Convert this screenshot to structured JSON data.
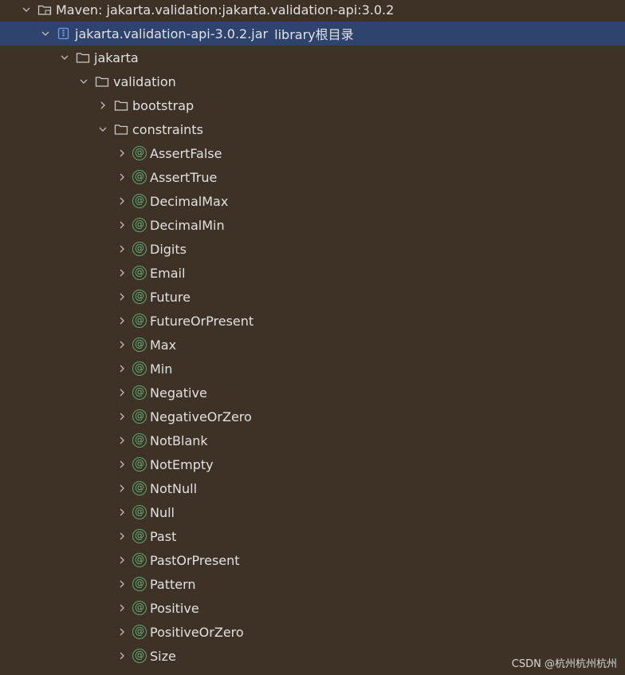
{
  "tree": {
    "root_label": "Maven: jakarta.validation:jakarta.validation-api:3.0.2",
    "jar_label": "jakarta.validation-api-3.0.2.jar",
    "jar_suffix": "library根目录",
    "pkg_jakarta": "jakarta",
    "pkg_validation": "validation",
    "pkg_bootstrap": "bootstrap",
    "pkg_constraints": "constraints",
    "annotations": [
      "AssertFalse",
      "AssertTrue",
      "DecimalMax",
      "DecimalMin",
      "Digits",
      "Email",
      "Future",
      "FutureOrPresent",
      "Max",
      "Min",
      "Negative",
      "NegativeOrZero",
      "NotBlank",
      "NotEmpty",
      "NotNull",
      "Null",
      "Past",
      "PastOrPresent",
      "Pattern",
      "Positive",
      "PositiveOrZero",
      "Size"
    ],
    "annotation_glyph": "@"
  },
  "watermark": "CSDN @杭州杭州杭州",
  "colors": {
    "background": "#3d3225",
    "selected_row": "#2e436e",
    "annotation_icon": "#5ca673"
  }
}
